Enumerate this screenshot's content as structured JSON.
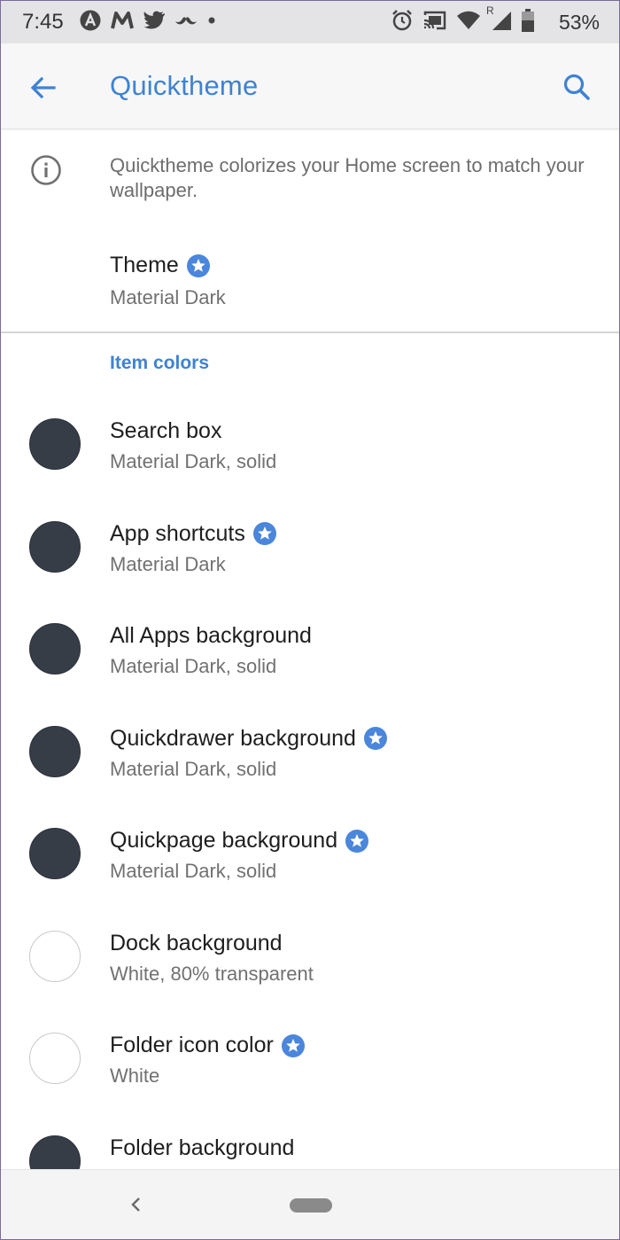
{
  "status_bar": {
    "time": "7:45",
    "battery_percent": "53%",
    "left_icons": [
      "anchor-a-icon",
      "m-icon",
      "twitter-icon",
      "mustache-icon",
      "dot-icon"
    ],
    "right_icons": [
      "alarm-icon",
      "cast-icon",
      "wifi-icon",
      "signal-icon",
      "battery-icon"
    ],
    "signal_roaming_label": "R"
  },
  "app_bar": {
    "title": "Quicktheme",
    "back_icon": "arrow-back-icon",
    "search_icon": "search-icon"
  },
  "info": {
    "icon": "info-icon",
    "text": "Quicktheme colorizes your Home screen to match your wallpaper."
  },
  "theme": {
    "title": "Theme",
    "value": "Material Dark",
    "premium": true
  },
  "section": {
    "header": "Item colors"
  },
  "items": [
    {
      "title": "Search box",
      "value": "Material Dark, solid",
      "premium": false,
      "swatch": "#363d46"
    },
    {
      "title": "App shortcuts",
      "value": "Material Dark",
      "premium": true,
      "swatch": "#363d46"
    },
    {
      "title": "All Apps background",
      "value": "Material Dark, solid",
      "premium": false,
      "swatch": "#363d46"
    },
    {
      "title": "Quickdrawer background",
      "value": "Material Dark, solid",
      "premium": true,
      "swatch": "#363d46"
    },
    {
      "title": "Quickpage background",
      "value": "Material Dark, solid",
      "premium": true,
      "swatch": "#363d46"
    },
    {
      "title": "Dock background",
      "value": "White, 80% transparent",
      "premium": false,
      "swatch": "#ffffff"
    },
    {
      "title": "Folder icon color",
      "value": "White",
      "premium": true,
      "swatch": "#ffffff"
    },
    {
      "title": "Folder background",
      "value": "",
      "premium": false,
      "swatch": "#363d46"
    }
  ],
  "colors": {
    "accent": "#3f82d1",
    "dark_swatch": "#363d46",
    "star_badge": "#4a86dc"
  },
  "nav_bar": {
    "back_icon": "nav-back-icon",
    "home_icon": "home-pill-icon"
  }
}
